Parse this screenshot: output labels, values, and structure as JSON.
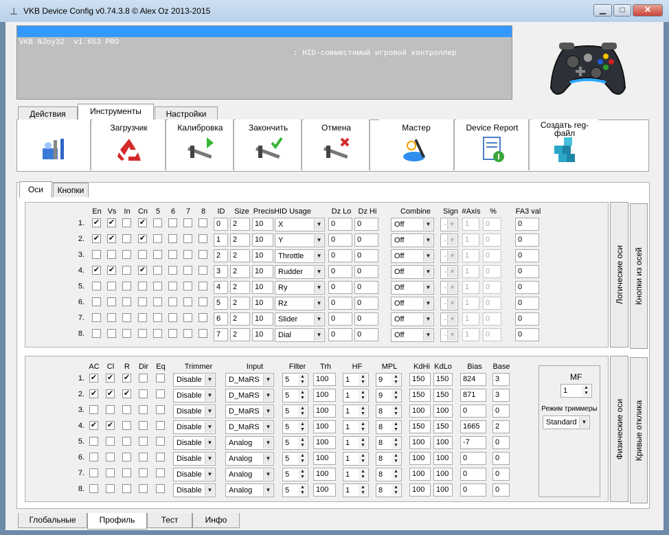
{
  "window": {
    "title": "VKB Device Config v0.74.3.8 © Alex Oz 2013-2015",
    "min": "▁",
    "max": "□",
    "close": "✕",
    "icon": "tripod-icon"
  },
  "device": {
    "name": "VKB NJoy32  v1.653 PRO",
    "desc": ": HID-совместимый игровой контроллер",
    "image": "gamepad-icon"
  },
  "main_tabs": [
    "Действия",
    "Инструменты",
    "Настройки"
  ],
  "toolbar": [
    {
      "label": "",
      "icon": "tools-icon"
    },
    {
      "label": "Загрузчик",
      "icon": "recycle-icon"
    },
    {
      "label": "Калибровка",
      "icon": "caliper-play-icon"
    },
    {
      "label": "Закончить",
      "icon": "caliper-check-icon"
    },
    {
      "label": "Отмена",
      "icon": "caliper-cancel-icon"
    },
    {
      "label": "Мастер",
      "icon": "wizard-icon"
    },
    {
      "label": "Device Report",
      "icon": "report-icon"
    },
    {
      "label": "Создать reg-файл",
      "icon": "registry-icon"
    }
  ],
  "sub_tabs": [
    "Оси",
    "Кнопки"
  ],
  "logical": {
    "checkbox_headers": [
      "En",
      "Vs",
      "In",
      "Cn",
      "5",
      "6",
      "7",
      "8"
    ],
    "field_headers": [
      "ID",
      "Size",
      "Precis",
      "HID Usage",
      "Dz Lo",
      "Dz Hi",
      "Combine",
      "Sign",
      "#Axis",
      "%",
      "FA3 val"
    ],
    "rows": [
      {
        "num": "1.",
        "checks": [
          true,
          true,
          false,
          true,
          false,
          false,
          false,
          false
        ],
        "id": "0",
        "size": "2",
        "precis": "10",
        "usage": "X",
        "dzlo": "0",
        "dzhi": "0",
        "combine": "Off",
        "sign": "-",
        "axis": "1",
        "pct": "0",
        "fa3": "0"
      },
      {
        "num": "2.",
        "checks": [
          true,
          true,
          false,
          true,
          false,
          false,
          false,
          false
        ],
        "id": "1",
        "size": "2",
        "precis": "10",
        "usage": "Y",
        "dzlo": "0",
        "dzhi": "0",
        "combine": "Off",
        "sign": "-",
        "axis": "1",
        "pct": "0",
        "fa3": "0"
      },
      {
        "num": "3.",
        "checks": [
          false,
          false,
          false,
          false,
          false,
          false,
          false,
          false
        ],
        "id": "2",
        "size": "2",
        "precis": "10",
        "usage": "Throttle",
        "dzlo": "0",
        "dzhi": "0",
        "combine": "Off",
        "sign": "-",
        "axis": "1",
        "pct": "0",
        "fa3": "0"
      },
      {
        "num": "4.",
        "checks": [
          true,
          true,
          false,
          true,
          false,
          false,
          false,
          false
        ],
        "id": "3",
        "size": "2",
        "precis": "10",
        "usage": "Rudder",
        "dzlo": "0",
        "dzhi": "0",
        "combine": "Off",
        "sign": "-",
        "axis": "1",
        "pct": "0",
        "fa3": "0"
      },
      {
        "num": "5.",
        "checks": [
          false,
          false,
          false,
          false,
          false,
          false,
          false,
          false
        ],
        "id": "4",
        "size": "2",
        "precis": "10",
        "usage": "Ry",
        "dzlo": "0",
        "dzhi": "0",
        "combine": "Off",
        "sign": "-",
        "axis": "1",
        "pct": "0",
        "fa3": "0"
      },
      {
        "num": "6.",
        "checks": [
          false,
          false,
          false,
          false,
          false,
          false,
          false,
          false
        ],
        "id": "5",
        "size": "2",
        "precis": "10",
        "usage": "Rz",
        "dzlo": "0",
        "dzhi": "0",
        "combine": "Off",
        "sign": "-",
        "axis": "1",
        "pct": "0",
        "fa3": "0"
      },
      {
        "num": "7.",
        "checks": [
          false,
          false,
          false,
          false,
          false,
          false,
          false,
          false
        ],
        "id": "6",
        "size": "2",
        "precis": "10",
        "usage": "Slider",
        "dzlo": "0",
        "dzhi": "0",
        "combine": "Off",
        "sign": "-",
        "axis": "1",
        "pct": "0",
        "fa3": "0"
      },
      {
        "num": "8.",
        "checks": [
          false,
          false,
          false,
          false,
          false,
          false,
          false,
          false
        ],
        "id": "7",
        "size": "2",
        "precis": "10",
        "usage": "Dial",
        "dzlo": "0",
        "dzhi": "0",
        "combine": "Off",
        "sign": "-",
        "axis": "1",
        "pct": "0",
        "fa3": "0"
      }
    ]
  },
  "logical_side_tabs": [
    "Логические оси",
    "Кнопки из осей"
  ],
  "physical": {
    "checkbox_headers": [
      "AC",
      "Cl",
      "R",
      "Dir",
      "Eq"
    ],
    "field_headers": [
      "Trimmer",
      "Input",
      "Filter",
      "Trh",
      "HF",
      "MPL",
      "KdHi",
      "KdLo",
      "Bias",
      "Base"
    ],
    "rows": [
      {
        "num": "1.",
        "checks": [
          true,
          true,
          true,
          false,
          false
        ],
        "trimmer": "Disable",
        "input": "D_MaRS",
        "filter": "5",
        "trh": "100",
        "hf": "1",
        "mpl": "9",
        "kdhi": "150",
        "kdlo": "150",
        "bias": "824",
        "base": "3"
      },
      {
        "num": "2.",
        "checks": [
          true,
          true,
          true,
          false,
          false
        ],
        "trimmer": "Disable",
        "input": "D_MaRS",
        "filter": "5",
        "trh": "100",
        "hf": "1",
        "mpl": "9",
        "kdhi": "150",
        "kdlo": "150",
        "bias": "871",
        "base": "3"
      },
      {
        "num": "3.",
        "checks": [
          false,
          false,
          false,
          false,
          false
        ],
        "trimmer": "Disable",
        "input": "D_MaRS",
        "filter": "5",
        "trh": "100",
        "hf": "1",
        "mpl": "8",
        "kdhi": "100",
        "kdlo": "100",
        "bias": "0",
        "base": "0"
      },
      {
        "num": "4.",
        "checks": [
          true,
          true,
          false,
          false,
          false
        ],
        "trimmer": "Disable",
        "input": "D_MaRS",
        "filter": "5",
        "trh": "100",
        "hf": "1",
        "mpl": "8",
        "kdhi": "150",
        "kdlo": "150",
        "bias": "1665",
        "base": "2"
      },
      {
        "num": "5.",
        "checks": [
          false,
          false,
          false,
          false,
          false
        ],
        "trimmer": "Disable",
        "input": "Analog",
        "filter": "5",
        "trh": "100",
        "hf": "1",
        "mpl": "8",
        "kdhi": "100",
        "kdlo": "100",
        "bias": "-7",
        "base": "0"
      },
      {
        "num": "6.",
        "checks": [
          false,
          false,
          false,
          false,
          false
        ],
        "trimmer": "Disable",
        "input": "Analog",
        "filter": "5",
        "trh": "100",
        "hf": "1",
        "mpl": "8",
        "kdhi": "100",
        "kdlo": "100",
        "bias": "0",
        "base": "0"
      },
      {
        "num": "7.",
        "checks": [
          false,
          false,
          false,
          false,
          false
        ],
        "trimmer": "Disable",
        "input": "Analog",
        "filter": "5",
        "trh": "100",
        "hf": "1",
        "mpl": "8",
        "kdhi": "100",
        "kdlo": "100",
        "bias": "0",
        "base": "0"
      },
      {
        "num": "8.",
        "checks": [
          false,
          false,
          false,
          false,
          false
        ],
        "trimmer": "Disable",
        "input": "Analog",
        "filter": "5",
        "trh": "100",
        "hf": "1",
        "mpl": "8",
        "kdhi": "100",
        "kdlo": "100",
        "bias": "0",
        "base": "0"
      }
    ]
  },
  "mf": {
    "label": "MF",
    "value": "1",
    "trim_label": "Режим триммеры",
    "trim_value": "Standard"
  },
  "physical_side_tabs": [
    "Физические оси",
    "Кривые отклика"
  ],
  "bottom_tabs": [
    "Глобальные",
    "Профиль",
    "Тест",
    "Инфо"
  ],
  "colors": {
    "selection": "#3399ff",
    "titlebar": "#b9d1ea",
    "desktop": "#6d8aa8"
  }
}
